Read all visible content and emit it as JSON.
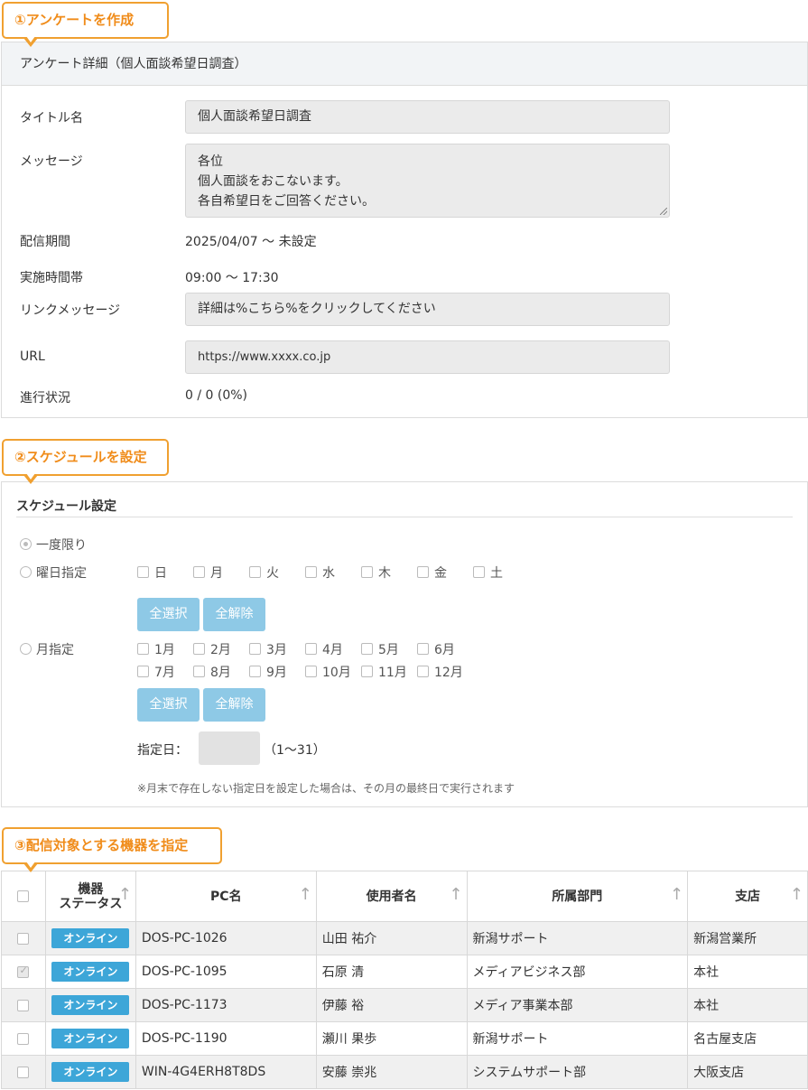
{
  "callouts": {
    "step1": "①アンケートを作成",
    "step2": "②スケジュールを設定",
    "step3": "③配信対象とする機器を指定"
  },
  "survey": {
    "header": "アンケート詳細（個人面談希望日調査）",
    "title_label": "タイトル名",
    "title_value": "個人面談希望日調査",
    "message_label": "メッセージ",
    "message_lines": [
      "各位",
      "個人面談をおこないます。",
      "各自希望日をご回答ください。"
    ],
    "period_label": "配信期間",
    "period_value": "2025/04/07 ～ 未設定",
    "hours_label": "実施時間帯",
    "hours_value": "09:00 ～ 17:30",
    "link_label": "リンクメッセージ",
    "link_value": "詳細は%こちら%をクリックしてください",
    "url_label": "URL",
    "url_value": "https://www.xxxx.co.jp",
    "progress_label": "進行状況",
    "progress_value": "0 / 0 (0%)"
  },
  "schedule": {
    "title": "スケジュール設定",
    "once_label": "一度限り",
    "weekday_label": "曜日指定",
    "weekdays": [
      "日",
      "月",
      "火",
      "水",
      "木",
      "金",
      "土"
    ],
    "select_all": "全選択",
    "clear_all": "全解除",
    "month_label": "月指定",
    "months_row1": [
      "1月",
      "2月",
      "3月",
      "4月",
      "5月",
      "6月"
    ],
    "months_row2": [
      "7月",
      "8月",
      "9月",
      "10月",
      "11月",
      "12月"
    ],
    "day_label": "指定日：",
    "day_range": "（1～31）",
    "note": "※月末で存在しない指定日を設定した場合は、その月の最終日で実行されます"
  },
  "devices": {
    "columns": [
      "機器\nステータス",
      "PC名",
      "使用者名",
      "所属部門",
      "支店"
    ],
    "rows": [
      {
        "checked": false,
        "status": "オンライン",
        "pc": "DOS-PC-1026",
        "user": "山田 祐介",
        "dept": "新潟サポート",
        "branch": "新潟営業所"
      },
      {
        "checked": true,
        "status": "オンライン",
        "pc": "DOS-PC-1095",
        "user": "石原 清",
        "dept": "メディアビジネス部",
        "branch": "本社"
      },
      {
        "checked": false,
        "status": "オンライン",
        "pc": "DOS-PC-1173",
        "user": "伊藤 裕",
        "dept": "メディア事業本部",
        "branch": "本社"
      },
      {
        "checked": false,
        "status": "オンライン",
        "pc": "DOS-PC-1190",
        "user": "瀬川 果歩",
        "dept": "新潟サポート",
        "branch": "名古屋支店"
      },
      {
        "checked": false,
        "status": "オンライン",
        "pc": "WIN-4G4ERH8T8DS",
        "user": "安藤 崇兆",
        "dept": "システムサポート部",
        "branch": "大阪支店"
      }
    ]
  },
  "colors": {
    "callout": "#f0a030",
    "badge": "#3da6d8",
    "button": "#8ec9e6"
  }
}
